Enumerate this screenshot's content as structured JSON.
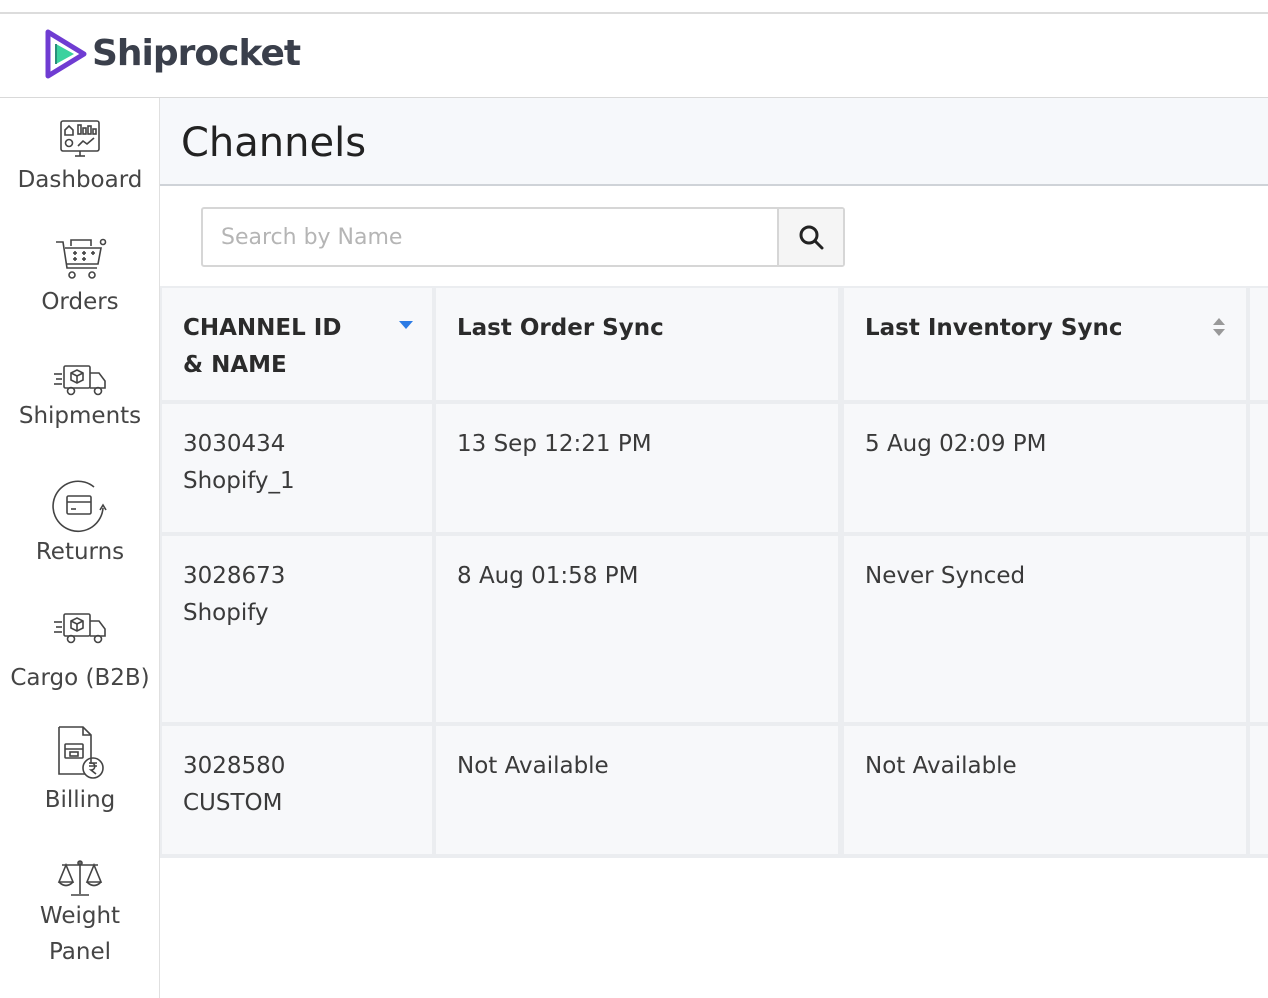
{
  "brand": {
    "name": "Shiprocket",
    "accent": "#6f3cd2",
    "accent_green": "#3ad29f"
  },
  "sidebar": {
    "items": [
      {
        "label": "Dashboard",
        "icon": "dashboard-icon"
      },
      {
        "label": "Orders",
        "icon": "cart-icon"
      },
      {
        "label": "Shipments",
        "icon": "truck-icon"
      },
      {
        "label": "Returns",
        "icon": "return-icon"
      },
      {
        "label": "Cargo (B2B)",
        "icon": "cargo-truck-icon"
      },
      {
        "label": "Billing",
        "icon": "billing-icon"
      },
      {
        "label": "Weight Panel",
        "icon": "scale-icon"
      }
    ]
  },
  "page": {
    "title": "Channels"
  },
  "search": {
    "placeholder": "Search by Name",
    "button_icon": "search-icon"
  },
  "table": {
    "columns": [
      {
        "label": "CHANNEL ID & NAME",
        "sort": "desc"
      },
      {
        "label": "Last Order Sync",
        "sort": "none"
      },
      {
        "label": "Last Inventory Sync",
        "sort": "both"
      }
    ],
    "rows": [
      {
        "id": "3030434",
        "name": "Shopify_1",
        "last_order_sync": "13 Sep 12:21 PM",
        "last_inventory_sync": "5 Aug 02:09 PM"
      },
      {
        "id": "3028673",
        "name": "Shopify",
        "last_order_sync": "8 Aug 01:58 PM",
        "last_inventory_sync": "Never Synced"
      },
      {
        "id": "3028580",
        "name": "CUSTOM",
        "last_order_sync": "Not Available",
        "last_inventory_sync": "Not Available"
      }
    ]
  }
}
